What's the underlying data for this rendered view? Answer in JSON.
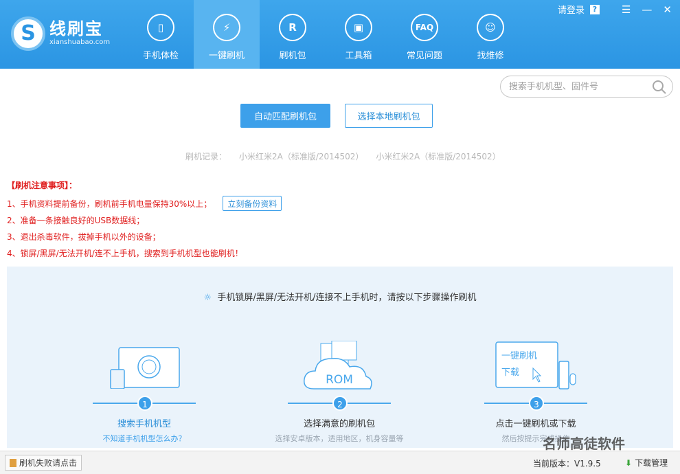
{
  "app": {
    "name": "线刷宝",
    "domain": "xianshuabao.com"
  },
  "window": {
    "login": "请登录",
    "help": "?",
    "menu": "☰",
    "minimize": "—",
    "close": "✕"
  },
  "nav": [
    {
      "label": "手机体检",
      "icon": "phone-check-icon",
      "glyph": "▯",
      "active": false
    },
    {
      "label": "一键刷机",
      "icon": "lightning-icon",
      "glyph": "⚡",
      "active": true
    },
    {
      "label": "刷机包",
      "icon": "rom-package-icon",
      "glyph": "R",
      "active": false
    },
    {
      "label": "工具箱",
      "icon": "toolbox-icon",
      "glyph": "▣",
      "active": false
    },
    {
      "label": "常见问题",
      "icon": "faq-icon",
      "glyph": "FAQ",
      "active": false
    },
    {
      "label": "找维修",
      "icon": "repair-person-icon",
      "glyph": "☺",
      "active": false
    }
  ],
  "search": {
    "placeholder": "搜索手机机型、固件号"
  },
  "actions": {
    "auto_match": "自动匹配刷机包",
    "local_pkg": "选择本地刷机包"
  },
  "history": {
    "label": "刷机记录：",
    "items": [
      "小米红米2A（标准版/2014502）",
      "小米红米2A（标准版/2014502）"
    ]
  },
  "notes": {
    "title": "【刷机注意事项】：",
    "items": [
      "1、手机资料提前备份，刷机前手机电量保持30%以上；",
      "2、准备一条接触良好的USB数据线；",
      "3、退出杀毒软件，拔掉手机以外的设备；",
      "4、锁屏/黑屏/无法开机/连不上手机，搜索到手机机型也能刷机！"
    ],
    "backup_button": "立刻备份资料"
  },
  "guide": {
    "title": "手机锁屏/黑屏/无法开机/连接不上手机时，请按以下步骤操作刷机",
    "steps": [
      {
        "num": "1",
        "title": "搜索手机机型",
        "sub": "不知道手机机型怎么办？"
      },
      {
        "num": "2",
        "title": "选择满意的刷机包",
        "sub": "选择安卓版本，适用地区，机身容量等"
      },
      {
        "num": "3",
        "title": "点击一键刷机或下载",
        "sub": "然后按提示完成操作"
      }
    ],
    "step2_rom": "ROM",
    "step3_line1": "一键刷机",
    "step3_line2": "下载"
  },
  "status": {
    "fail_help": "刷机失败请点击",
    "version": "当前版本：V1.9.5",
    "download_mgr": "下载管理"
  },
  "watermark": "名师高徒软件",
  "colors": {
    "primary": "#3da0ea",
    "header": "#2b95e3",
    "warning": "#e02020"
  }
}
